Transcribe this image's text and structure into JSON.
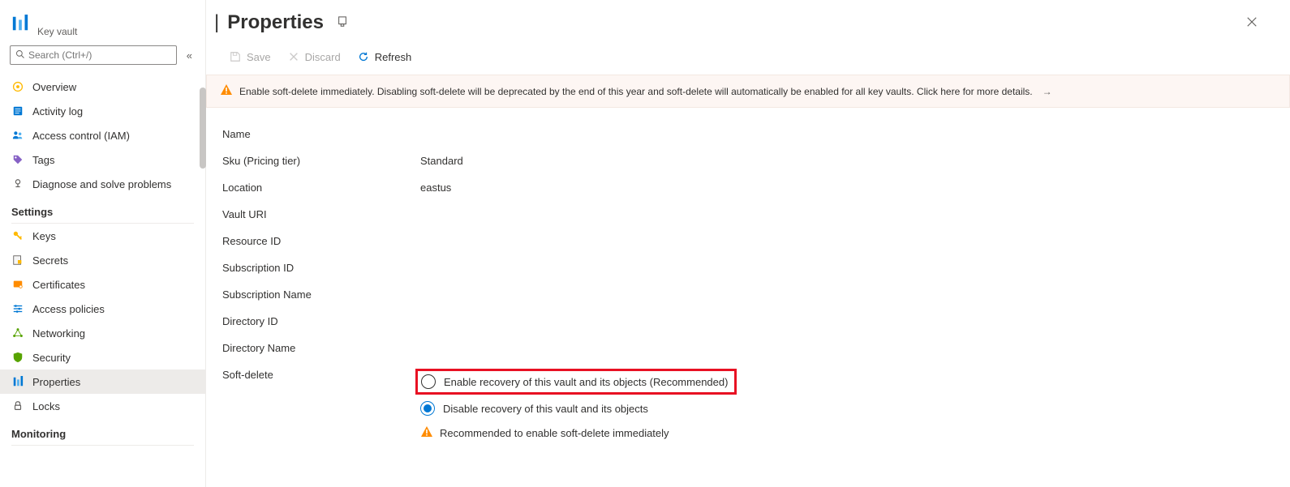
{
  "sidebar": {
    "subtitle": "Key vault",
    "search_placeholder": "Search (Ctrl+/)",
    "items_top": [
      {
        "label": "Overview"
      },
      {
        "label": "Activity log"
      },
      {
        "label": "Access control (IAM)"
      },
      {
        "label": "Tags"
      },
      {
        "label": "Diagnose and solve problems"
      }
    ],
    "settings_title": "Settings",
    "items_settings": [
      {
        "label": "Keys"
      },
      {
        "label": "Secrets"
      },
      {
        "label": "Certificates"
      },
      {
        "label": "Access policies"
      },
      {
        "label": "Networking"
      },
      {
        "label": "Security"
      },
      {
        "label": "Properties"
      },
      {
        "label": "Locks"
      }
    ],
    "monitoring_title": "Monitoring"
  },
  "header": {
    "title": "Properties"
  },
  "toolbar": {
    "save": "Save",
    "discard": "Discard",
    "refresh": "Refresh"
  },
  "banner": {
    "text": "Enable soft-delete immediately. Disabling soft-delete will be deprecated by the end of this year and soft-delete will automatically be enabled for all key vaults. Click here for more details."
  },
  "properties": {
    "name_label": "Name",
    "name_value": "",
    "sku_label": "Sku (Pricing tier)",
    "sku_value": "Standard",
    "location_label": "Location",
    "location_value": "eastus",
    "vault_uri_label": "Vault URI",
    "vault_uri_value": "",
    "resource_id_label": "Resource ID",
    "resource_id_value": "",
    "subscription_id_label": "Subscription ID",
    "subscription_id_value": "",
    "subscription_name_label": "Subscription Name",
    "subscription_name_value": "",
    "directory_id_label": "Directory ID",
    "directory_id_value": "",
    "directory_name_label": "Directory Name",
    "directory_name_value": "",
    "soft_delete_label": "Soft-delete"
  },
  "soft_delete": {
    "option_enable": "Enable recovery of this vault and its objects (Recommended)",
    "option_disable": "Disable recovery of this vault and its objects",
    "warning": "Recommended to enable soft-delete immediately"
  }
}
